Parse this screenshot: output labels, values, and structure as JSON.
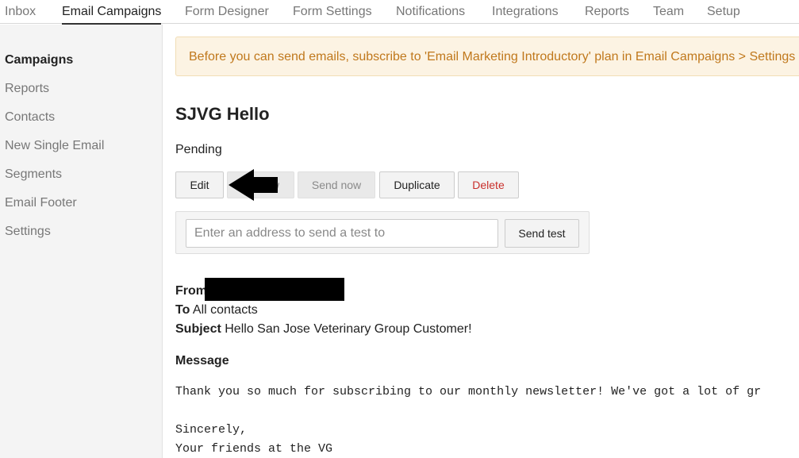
{
  "topnav": {
    "tabs": [
      {
        "label": "Inbox"
      },
      {
        "label": "Email Campaigns",
        "active": true
      },
      {
        "label": "Form Designer"
      },
      {
        "label": "Form Settings"
      },
      {
        "label": "Notifications"
      },
      {
        "label": "Integrations"
      },
      {
        "label": "Reports"
      },
      {
        "label": "Team"
      },
      {
        "label": "Setup"
      }
    ]
  },
  "sidebar": {
    "items": [
      {
        "label": "Campaigns",
        "active": true
      },
      {
        "label": "Reports"
      },
      {
        "label": "Contacts"
      },
      {
        "label": "New Single Email"
      },
      {
        "label": "Segments"
      },
      {
        "label": "Email Footer"
      },
      {
        "label": "Settings"
      }
    ]
  },
  "alert": {
    "text": "Before you can send emails, subscribe to 'Email Marketing Introductory' plan in Email Campaigns > Settings"
  },
  "campaign": {
    "title": "SJVG Hello",
    "status": "Pending"
  },
  "actions": {
    "edit": "Edit",
    "preview_partial": "w",
    "send_now": "Send now",
    "duplicate": "Duplicate",
    "delete": "Delete"
  },
  "test": {
    "placeholder": "Enter an address to send a test to",
    "button": "Send test"
  },
  "meta": {
    "from_label": "From",
    "to_label": "To",
    "to_value": "All contacts",
    "subject_label": "Subject",
    "subject_value": "Hello San Jose Veterinary Group Customer!"
  },
  "message": {
    "label": "Message",
    "lines": [
      "Thank you so much for subscribing to our monthly newsletter! We've got a lot of gr",
      "Sincerely,",
      "Your friends at the VG"
    ]
  },
  "colors": {
    "alert_bg": "#fcf3e3",
    "alert_text": "#c0781c",
    "danger": "#c9302c"
  }
}
